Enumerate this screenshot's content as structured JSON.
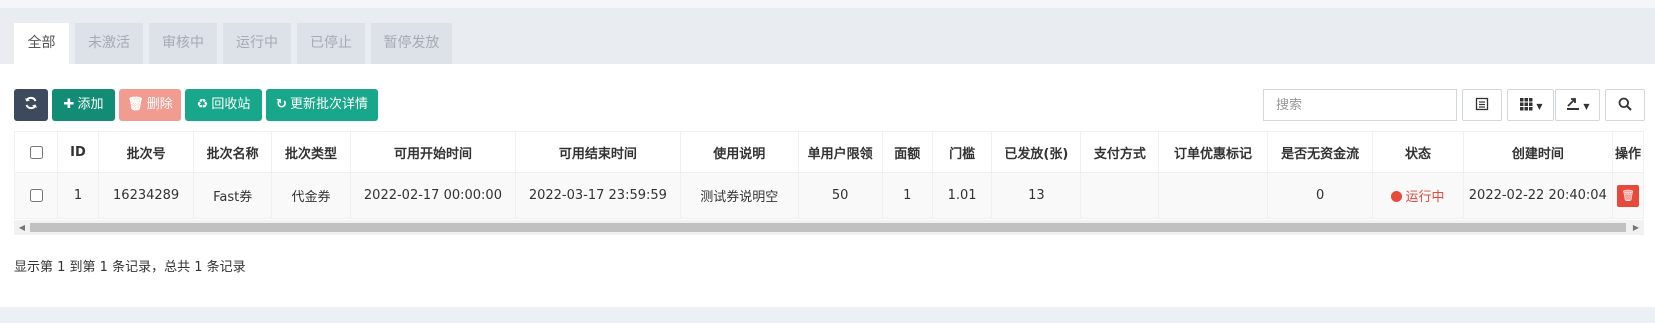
{
  "tabs": [
    {
      "label": "全部",
      "active": true
    },
    {
      "label": "未激活",
      "active": false
    },
    {
      "label": "审核中",
      "active": false
    },
    {
      "label": "运行中",
      "active": false
    },
    {
      "label": "已停止",
      "active": false
    },
    {
      "label": "暂停发放",
      "active": false
    }
  ],
  "toolbar": {
    "refresh_icon": "refresh-icon",
    "add_label": "添加",
    "delete_label": "删除",
    "recycle_label": "回收站",
    "update_label": "更新批次详情"
  },
  "search": {
    "placeholder": "搜索",
    "value": ""
  },
  "table": {
    "headers": [
      "ID",
      "批次号",
      "批次名称",
      "批次类型",
      "可用开始时间",
      "可用结束时间",
      "使用说明",
      "单用户限领",
      "面额",
      "门槛",
      "已发放(张)",
      "支付方式",
      "订单优惠标记",
      "是否无资金流",
      "状态",
      "创建时间",
      "操作"
    ],
    "rows": [
      {
        "id": "1",
        "batch_no": "16234289",
        "batch_name": "Fast券",
        "batch_type": "代金券",
        "start_time": "2022-02-17 00:00:00",
        "end_time": "2022-03-17 23:59:59",
        "description": "测试券说明空",
        "per_user_limit": "50",
        "face_value": "1",
        "threshold": "1.01",
        "issued": "13",
        "pay_method": "",
        "order_mark": "",
        "no_cash_flow": "0",
        "status": "运行中",
        "created_at": "2022-02-22 20:40:04"
      }
    ]
  },
  "pagination": {
    "info": "显示第 1 到第 1 条记录，总共 1 条记录"
  },
  "colors": {
    "accent_green": "#18a78a",
    "danger": "#e7493b",
    "dark": "#3d4a5d"
  }
}
